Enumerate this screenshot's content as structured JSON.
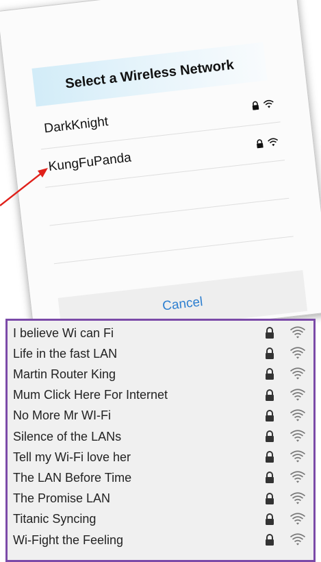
{
  "dialog": {
    "title": "Select a Wireless Network",
    "networks": [
      {
        "name": "DarkKnight",
        "lock_icon": "lock-icon",
        "wifi_icon": "wifi-icon"
      },
      {
        "name": "KungFuPanda",
        "lock_icon": "lock-icon",
        "wifi_icon": "wifi-icon"
      }
    ],
    "cancel_label": "Cancel"
  },
  "network_list": {
    "items": [
      {
        "name": "I believe Wi can Fi"
      },
      {
        "name": "Life in the fast LAN"
      },
      {
        "name": "Martin Router King"
      },
      {
        "name": "Mum Click Here For Internet"
      },
      {
        "name": "No More Mr WI-Fi"
      },
      {
        "name": "Silence of the LANs"
      },
      {
        "name": "Tell my Wi-Fi love her"
      },
      {
        "name": "The LAN Before Time"
      },
      {
        "name": "The Promise LAN"
      },
      {
        "name": "Titanic Syncing"
      },
      {
        "name": "Wi-Fight the Feeling"
      }
    ]
  },
  "colors": {
    "accent": "#2d7fd0",
    "arrow": "#e0201a",
    "list_border": "#7b4aa8",
    "title_bar": "#d2ecf8"
  }
}
